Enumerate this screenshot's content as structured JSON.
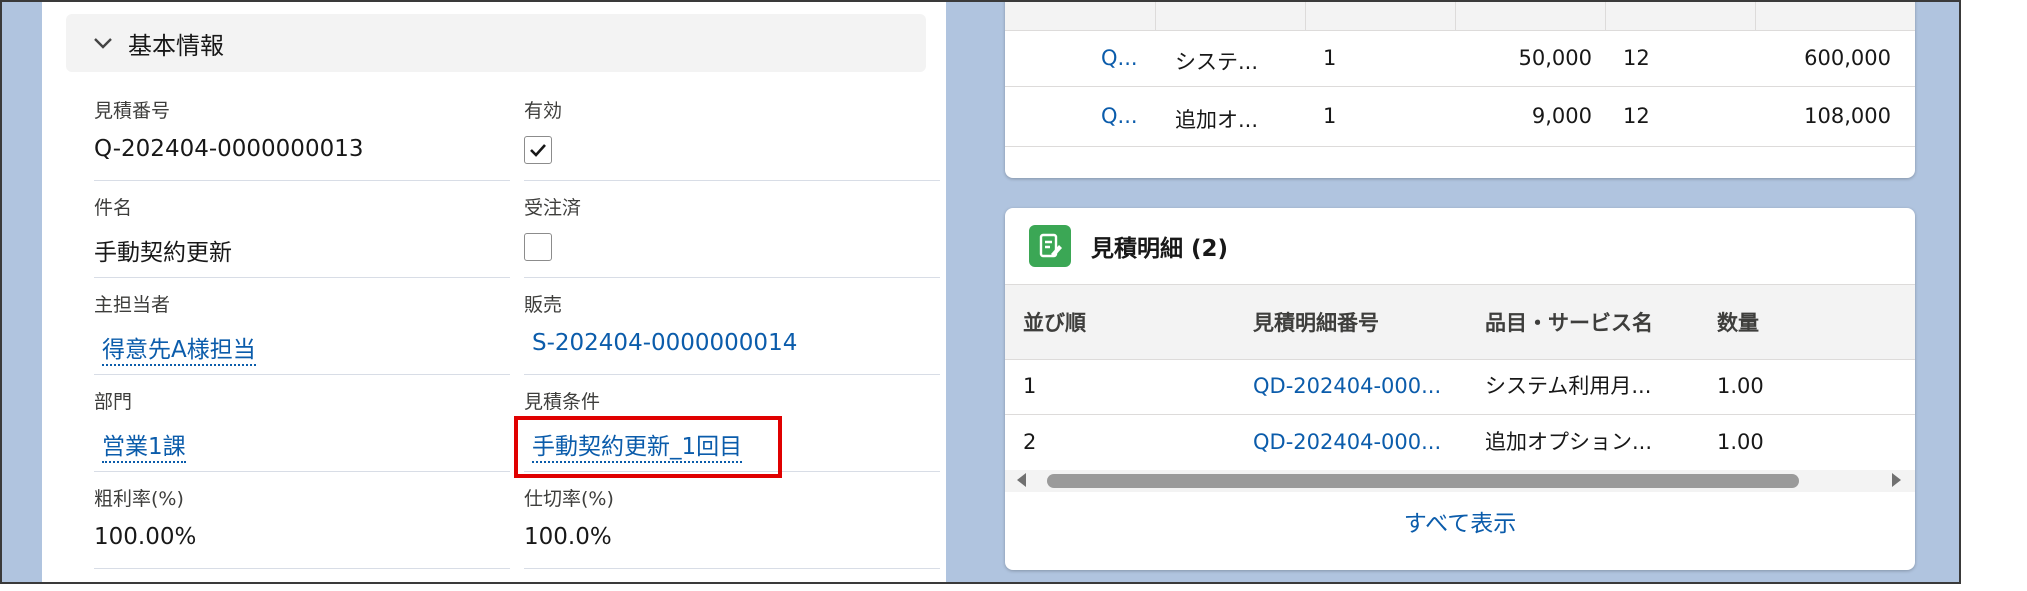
{
  "basic_info": {
    "title": "基本情報",
    "fields": {
      "quote_number": {
        "label": "見積番号",
        "value": "Q-202404-0000000013"
      },
      "active": {
        "label": "有効",
        "checked": true
      },
      "subject": {
        "label": "件名",
        "value": "手動契約更新"
      },
      "ordered": {
        "label": "受注済",
        "checked": false
      },
      "owner": {
        "label": "主担当者",
        "value": "得意先A様担当"
      },
      "sales": {
        "label": "販売",
        "value": "S-202404-0000000014"
      },
      "department": {
        "label": "部門",
        "value": "営業1課"
      },
      "quote_terms": {
        "label": "見積条件",
        "value": "手動契約更新_1回目"
      },
      "gross_margin": {
        "label": "粗利率(%)",
        "value": "100.00%"
      },
      "wholesale_rate": {
        "label": "仕切率(%)",
        "value": "100.0%"
      }
    }
  },
  "top_table": {
    "rows": [
      {
        "col1": "Q...",
        "col2": "システ...",
        "col3": "1",
        "col4": "50,000",
        "col5": "12",
        "col6": "600,000"
      },
      {
        "col1": "Q...",
        "col2": "追加オ...",
        "col3": "1",
        "col4": "9,000",
        "col5": "12",
        "col6": "108,000"
      }
    ]
  },
  "line_items": {
    "title": "見積明細 (2)",
    "columns": [
      "並び順",
      "見積明細番号",
      "品目・サービス名",
      "数量"
    ],
    "rows": [
      {
        "order": "1",
        "number": "QD-202404-000...",
        "item": "システム利用月...",
        "qty": "1.00"
      },
      {
        "order": "2",
        "number": "QD-202404-000...",
        "item": "追加オプション...",
        "qty": "1.00"
      }
    ],
    "view_all": "すべて表示"
  },
  "colors": {
    "link": "#0b5cab",
    "highlight": "#e00000",
    "icon_green": "#3ba755",
    "background": "#b0c4df"
  }
}
